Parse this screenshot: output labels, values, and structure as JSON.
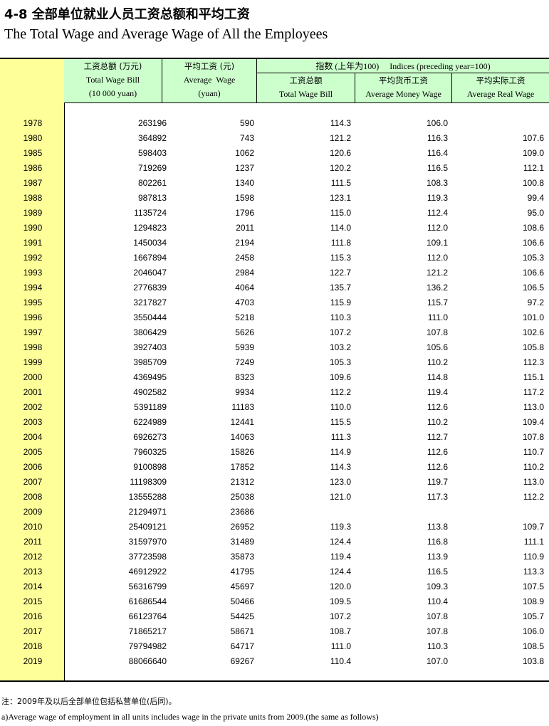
{
  "title": {
    "cn": "4-8 全部单位就业人员工资总额和平均工资",
    "en": "The Total Wage and Average Wage of All the Employees"
  },
  "header": {
    "bill_cn": "工资总额 (万元)",
    "bill_en": "Total Wage Bill",
    "bill_unit": "(10 000 yuan)",
    "avg_cn": "平均工资 (元)",
    "avg_en": "Average  Wage",
    "avg_unit": "(yuan)",
    "indices_label": "指数 (上年为100)     Indices (preceding year=100)",
    "idx_bill_cn": "工资总额",
    "idx_bill_en": "Total Wage Bill",
    "idx_money_cn": "平均货币工资",
    "idx_money_en": "Average Money Wage",
    "idx_real_cn": "平均实际工资",
    "idx_real_en": "Average Real Wage"
  },
  "rows": [
    [
      "1978",
      "263196",
      "590",
      "114.3",
      "106.0",
      ""
    ],
    [
      "1980",
      "364892",
      "743",
      "121.2",
      "116.3",
      "107.6"
    ],
    [
      "1985",
      "598403",
      "1062",
      "120.6",
      "116.4",
      "109.0"
    ],
    [
      "1986",
      "719269",
      "1237",
      "120.2",
      "116.5",
      "112.1"
    ],
    [
      "1987",
      "802261",
      "1340",
      "111.5",
      "108.3",
      "100.8"
    ],
    [
      "1988",
      "987813",
      "1598",
      "123.1",
      "119.3",
      "99.4"
    ],
    [
      "1989",
      "1135724",
      "1796",
      "115.0",
      "112.4",
      "95.0"
    ],
    [
      "1990",
      "1294823",
      "2011",
      "114.0",
      "112.0",
      "108.6"
    ],
    [
      "1991",
      "1450034",
      "2194",
      "111.8",
      "109.1",
      "106.6"
    ],
    [
      "1992",
      "1667894",
      "2458",
      "115.3",
      "112.0",
      "105.3"
    ],
    [
      "1993",
      "2046047",
      "2984",
      "122.7",
      "121.2",
      "106.6"
    ],
    [
      "1994",
      "2776839",
      "4064",
      "135.7",
      "136.2",
      "106.5"
    ],
    [
      "1995",
      "3217827",
      "4703",
      "115.9",
      "115.7",
      "97.2"
    ],
    [
      "1996",
      "3550444",
      "5218",
      "110.3",
      "111.0",
      "101.0"
    ],
    [
      "1997",
      "3806429",
      "5626",
      "107.2",
      "107.8",
      "102.6"
    ],
    [
      "1998",
      "3927403",
      "5939",
      "103.2",
      "105.6",
      "105.8"
    ],
    [
      "1999",
      "3985709",
      "7249",
      "105.3",
      "110.2",
      "112.3"
    ],
    [
      "2000",
      "4369495",
      "8323",
      "109.6",
      "114.8",
      "115.1"
    ],
    [
      "2001",
      "4902582",
      "9934",
      "112.2",
      "119.4",
      "117.2"
    ],
    [
      "2002",
      "5391189",
      "11183",
      "110.0",
      "112.6",
      "113.0"
    ],
    [
      "2003",
      "6224989",
      "12441",
      "115.5",
      "110.2",
      "109.4"
    ],
    [
      "2004",
      "6926273",
      "14063",
      "111.3",
      "112.7",
      "107.8"
    ],
    [
      "2005",
      "7960325",
      "15826",
      "114.9",
      "112.6",
      "110.7"
    ],
    [
      "2006",
      "9100898",
      "17852",
      "114.3",
      "112.6",
      "110.2"
    ],
    [
      "2007",
      "11198309",
      "21312",
      "123.0",
      "119.7",
      "113.0"
    ],
    [
      "2008",
      "13555288",
      "25038",
      "121.0",
      "117.3",
      "112.2"
    ],
    [
      "2009",
      "21294971",
      "23686",
      "",
      "",
      ""
    ],
    [
      "2010",
      "25409121",
      "26952",
      "119.3",
      "113.8",
      "109.7"
    ],
    [
      "2011",
      "31597970",
      "31489",
      "124.4",
      "116.8",
      "111.1"
    ],
    [
      "2012",
      "37723598",
      "35873",
      "119.4",
      "113.9",
      "110.9"
    ],
    [
      "2013",
      "46912922",
      "41795",
      "124.4",
      "116.5",
      "113.3"
    ],
    [
      "2014",
      "56316799",
      "45697",
      "120.0",
      "109.3",
      "107.5"
    ],
    [
      "2015",
      "61686544",
      "50466",
      "109.5",
      "110.4",
      "108.9"
    ],
    [
      "2016",
      "66123764",
      "54425",
      "107.2",
      "107.8",
      "105.7"
    ],
    [
      "2017",
      "71865217",
      "58671",
      "108.7",
      "107.8",
      "106.0"
    ],
    [
      "2018",
      "79794982",
      "64717",
      "111.0",
      "110.3",
      "108.5"
    ],
    [
      "2019",
      "88066640",
      "69267",
      "110.4",
      "107.0",
      "103.8"
    ]
  ],
  "notes": {
    "cn": "注：2009年及以后全部单位包括私营单位(后同)。",
    "en": "a)Average wage of employment in all units includes wage in the private units from 2009.(the same as follows)"
  }
}
